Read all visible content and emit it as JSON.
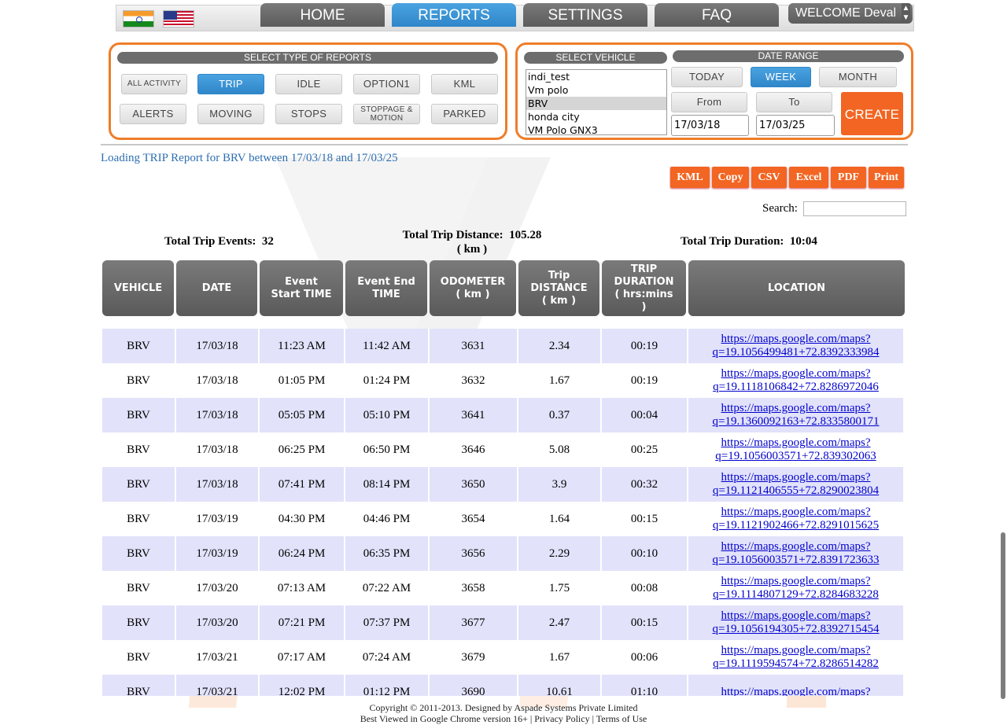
{
  "nav": {
    "tabs": [
      "HOME",
      "REPORTS",
      "SETTINGS",
      "FAQ"
    ],
    "active_tab": "REPORTS",
    "welcome": "WELCOME Deval"
  },
  "report_types": {
    "heading": "SELECT TYPE OF REPORTS",
    "row1": [
      "ALL ACTIVITY",
      "TRIP",
      "IDLE",
      "OPTION1",
      "KML"
    ],
    "row2": [
      "ALERTS",
      "MOVING",
      "STOPS",
      "STOPPAGE & MOTION",
      "PARKED"
    ],
    "active": "TRIP"
  },
  "vehicle": {
    "heading": "SELECT VEHICLE",
    "options": [
      "indi_test",
      "Vm polo",
      "BRV",
      "honda city",
      "VM Polo GNX3"
    ],
    "selected": "BRV"
  },
  "date_range": {
    "heading": "DATE RANGE",
    "periods": [
      "TODAY",
      "WEEK",
      "MONTH"
    ],
    "active_period": "WEEK",
    "from_label": "From",
    "to_label": "To",
    "from_value": "17/03/18",
    "to_value": "17/03/25",
    "create_label": "CREATE"
  },
  "status_text": "Loading TRIP Report for BRV between 17/03/18 and 17/03/25",
  "export_buttons": [
    "KML",
    "Copy",
    "CSV",
    "Excel",
    "PDF",
    "Print"
  ],
  "search_label": "Search:",
  "summary": {
    "events_label": "Total Trip Events:",
    "events_value": "32",
    "distance_label": "Total Trip Distance:",
    "distance_value": "105.28",
    "distance_unit": "( km )",
    "duration_label": "Total Trip Duration:",
    "duration_value": "10:04"
  },
  "table": {
    "headers": [
      "VEHICLE",
      "DATE",
      "Event\nStart TIME",
      "Event End\nTIME",
      "ODOMETER\n( km )",
      "Trip\nDISTANCE\n( km )",
      "TRIP\nDURATION\n( hrs:mins\n)",
      "LOCATION"
    ],
    "rows": [
      [
        "BRV",
        "17/03/18",
        "11:23 AM",
        "11:42 AM",
        "3631",
        "2.34",
        "00:19",
        "https://maps.google.com/maps?",
        "q=19.1056499481+72.8392333984"
      ],
      [
        "BRV",
        "17/03/18",
        "01:05 PM",
        "01:24 PM",
        "3632",
        "1.67",
        "00:19",
        "https://maps.google.com/maps?",
        "q=19.1118106842+72.8286972046"
      ],
      [
        "BRV",
        "17/03/18",
        "05:05 PM",
        "05:10 PM",
        "3641",
        "0.37",
        "00:04",
        "https://maps.google.com/maps?",
        "q=19.1360092163+72.8335800171"
      ],
      [
        "BRV",
        "17/03/18",
        "06:25 PM",
        "06:50 PM",
        "3646",
        "5.08",
        "00:25",
        "https://maps.google.com/maps?",
        "q=19.1056003571+72.839302063"
      ],
      [
        "BRV",
        "17/03/18",
        "07:41 PM",
        "08:14 PM",
        "3650",
        "3.9",
        "00:32",
        "https://maps.google.com/maps?",
        "q=19.1121406555+72.8290023804"
      ],
      [
        "BRV",
        "17/03/19",
        "04:30 PM",
        "04:46 PM",
        "3654",
        "1.64",
        "00:15",
        "https://maps.google.com/maps?",
        "q=19.1121902466+72.8291015625"
      ],
      [
        "BRV",
        "17/03/19",
        "06:24 PM",
        "06:35 PM",
        "3656",
        "2.29",
        "00:10",
        "https://maps.google.com/maps?",
        "q=19.1056003571+72.8391723633"
      ],
      [
        "BRV",
        "17/03/20",
        "07:13 AM",
        "07:22 AM",
        "3658",
        "1.75",
        "00:08",
        "https://maps.google.com/maps?",
        "q=19.1114807129+72.8284683228"
      ],
      [
        "BRV",
        "17/03/20",
        "07:21 PM",
        "07:37 PM",
        "3677",
        "2.47",
        "00:15",
        "https://maps.google.com/maps?",
        "q=19.1056194305+72.8392715454"
      ],
      [
        "BRV",
        "17/03/21",
        "07:17 AM",
        "07:24 AM",
        "3679",
        "1.67",
        "00:06",
        "https://maps.google.com/maps?",
        "q=19.1119594574+72.8286514282"
      ],
      [
        "BRV",
        "17/03/21",
        "12:02 PM",
        "01:12 PM",
        "3690",
        "10.61",
        "01:10",
        "https://maps.google.com/maps?",
        ""
      ]
    ]
  },
  "footer": {
    "line1": "Copyright © 2011-2013. Designed by Aspade Systems Private Limited",
    "line2": "Best Viewed in Google Chrome version 16+ | Privacy Policy | Terms of Use"
  },
  "colors": {
    "accent_orange": "#f26522",
    "active_blue": "#2f86c9",
    "header_gray": "#6d6d6d",
    "row_stripe": "#e2e2fb",
    "link_blue": "#0000cc"
  }
}
